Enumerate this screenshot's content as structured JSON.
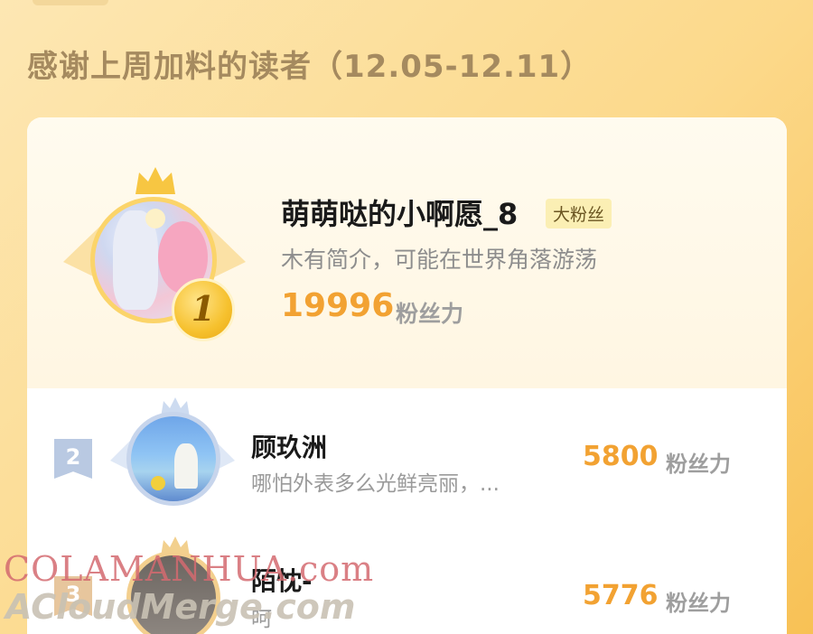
{
  "header": {
    "title": "感谢上周加料的读者（12.05-12.11）"
  },
  "top_reader": {
    "rank": "1",
    "name": "萌萌哒的小啊愿_8",
    "tag": "大粉丝",
    "bio": "木有简介，可能在世界角落游荡",
    "score": "19996",
    "score_unit": "粉丝力"
  },
  "readers": [
    {
      "rank": "2",
      "name": "顾玖洲",
      "bio": "哪怕外表多么光鲜亮丽，...",
      "score": "5800",
      "score_unit": "粉丝力"
    },
    {
      "rank": "3",
      "name": "陌忱-",
      "bio": "呵",
      "score": "5776",
      "score_unit": "粉丝力"
    }
  ],
  "watermarks": {
    "line1": "COLAMANHUA.com",
    "line2": "ACloudMerge.com"
  },
  "colors": {
    "accent": "#f2a232",
    "background": "#fcd98b",
    "name": "#1a1a1a"
  },
  "icons": [
    "crown-icon",
    "rank-badge-icon",
    "wing-icon"
  ]
}
